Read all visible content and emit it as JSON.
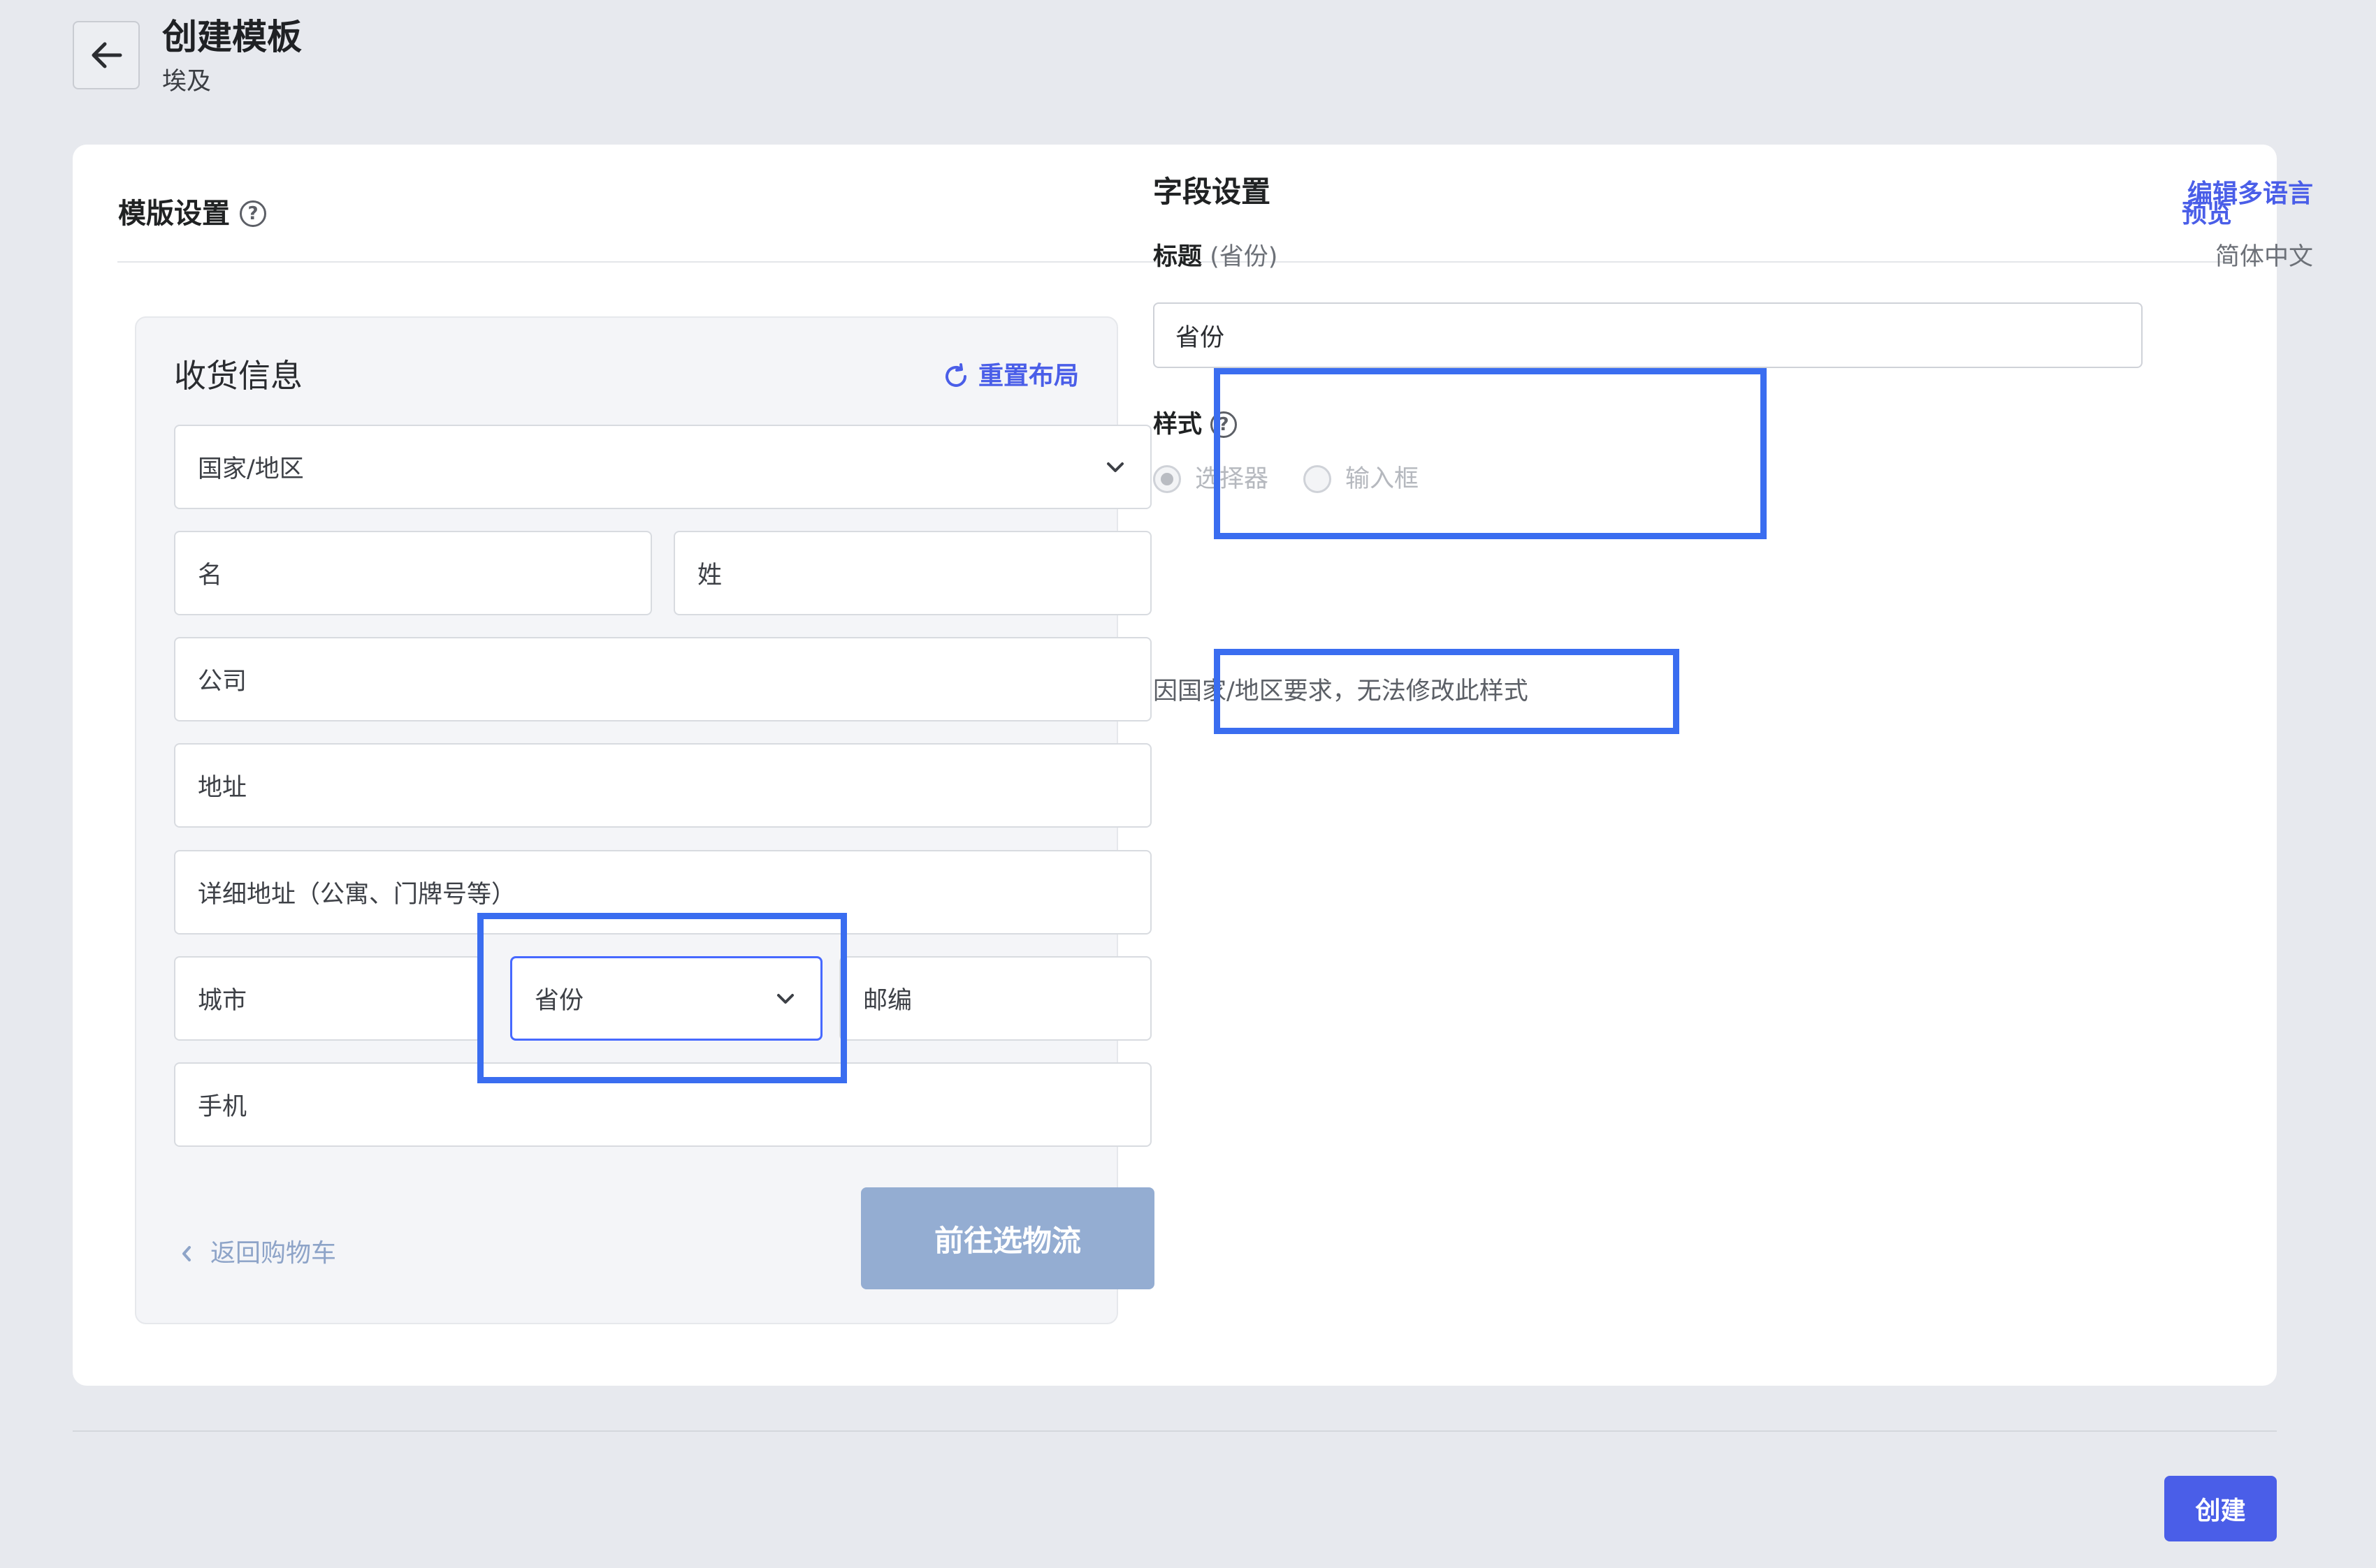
{
  "header": {
    "title": "创建模板",
    "subtitle": "埃及"
  },
  "card": {
    "title": "模版设置",
    "preview_label": "预览"
  },
  "checkout": {
    "title": "收货信息",
    "reset_label": "重置布局",
    "fields": {
      "country": "国家/地区",
      "first_name": "名",
      "last_name": "姓",
      "company": "公司",
      "address": "地址",
      "address2": "详细地址（公寓、门牌号等）",
      "city": "城市",
      "province": "省份",
      "zip": "邮编",
      "phone": "手机"
    },
    "back_label": "返回购物车",
    "next_label": "前往选物流"
  },
  "field_settings": {
    "title": "字段设置",
    "multilang_label": "编辑多语言",
    "label_heading": "标题",
    "label_hint": "(省份)",
    "language": "简体中文",
    "title_value": "省份",
    "style_label": "样式",
    "options": [
      "选择器",
      "输入框"
    ],
    "selected_option": "选择器",
    "notice": "因国家/地区要求，无法修改此样式"
  },
  "footer": {
    "create_label": "创建"
  },
  "colors": {
    "accent": "#4a5ee8",
    "highlight": "#3a6df0",
    "disabled_button": "#94add2"
  }
}
